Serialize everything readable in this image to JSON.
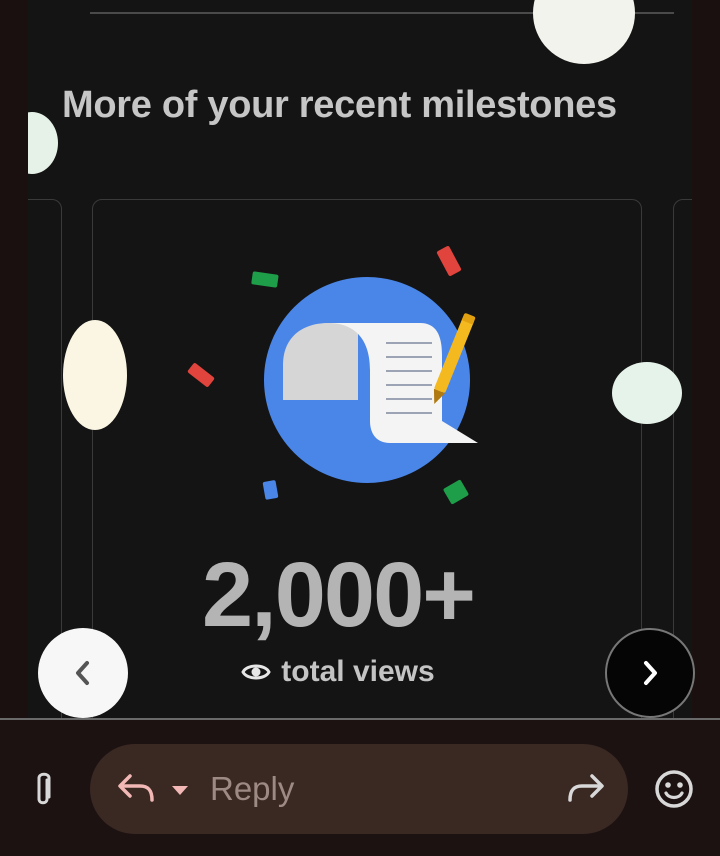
{
  "section": {
    "title": "More of your recent milestones"
  },
  "milestone": {
    "value": "2,000+",
    "label": "total views",
    "label_icon": "eye-icon",
    "illustration": "document-with-pencil-icon"
  },
  "carousel": {
    "prev_icon": "chevron-left-icon",
    "next_icon": "chevron-right-icon"
  },
  "compose": {
    "attach_icon": "paperclip-icon",
    "reply_icon": "reply-icon",
    "reply_menu_icon": "caret-down-icon",
    "reply_placeholder": "Reply",
    "forward_icon": "forward-icon",
    "emoji_icon": "emoji-icon"
  },
  "colors": {
    "background": "#141414",
    "accent_blue": "#4a86e8",
    "confetti_green": "#1e9e48",
    "confetti_red": "#e0443c",
    "confetti_yellow": "#f5b920",
    "reply_pill": "#3a2822",
    "reply_icon": "#f2b8b5"
  }
}
